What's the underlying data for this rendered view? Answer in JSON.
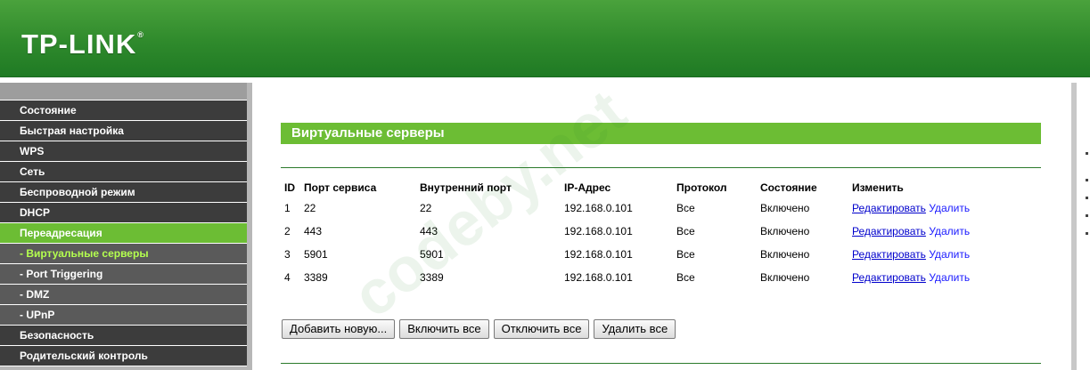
{
  "header": {
    "logo_text": "TP-LINK",
    "logo_mark": "®"
  },
  "sidebar": {
    "items": [
      {
        "label": "Состояние",
        "type": "main",
        "active": false
      },
      {
        "label": "Быстрая настройка",
        "type": "main",
        "active": false
      },
      {
        "label": "WPS",
        "type": "main",
        "active": false
      },
      {
        "label": "Сеть",
        "type": "main",
        "active": false
      },
      {
        "label": "Беспроводной режим",
        "type": "main",
        "active": false
      },
      {
        "label": "DHCP",
        "type": "main",
        "active": false
      },
      {
        "label": "Переадресация",
        "type": "main",
        "active": true
      },
      {
        "label": "- Виртуальные серверы",
        "type": "sub",
        "active": true
      },
      {
        "label": "- Port Triggering",
        "type": "sub",
        "active": false
      },
      {
        "label": "- DMZ",
        "type": "sub",
        "active": false
      },
      {
        "label": "- UPnP",
        "type": "sub",
        "active": false
      },
      {
        "label": "Безопасность",
        "type": "main",
        "active": false
      },
      {
        "label": "Родительский контроль",
        "type": "main",
        "active": false
      }
    ]
  },
  "main": {
    "title": "Виртуальные серверы",
    "table": {
      "headers": [
        "ID",
        "Порт сервиса",
        "Внутренний порт",
        "IP-Адрес",
        "Протокол",
        "Состояние",
        "Изменить"
      ],
      "rows": [
        {
          "id": "1",
          "service_port": "22",
          "internal_port": "22",
          "ip": "192.168.0.101",
          "protocol": "Все",
          "status": "Включено",
          "edit": "Редактировать",
          "delete": "Удалить"
        },
        {
          "id": "2",
          "service_port": "443",
          "internal_port": "443",
          "ip": "192.168.0.101",
          "protocol": "Все",
          "status": "Включено",
          "edit": "Редактировать",
          "delete": "Удалить"
        },
        {
          "id": "3",
          "service_port": "5901",
          "internal_port": "5901",
          "ip": "192.168.0.101",
          "protocol": "Все",
          "status": "Включено",
          "edit": "Редактировать",
          "delete": "Удалить"
        },
        {
          "id": "4",
          "service_port": "3389",
          "internal_port": "3389",
          "ip": "192.168.0.101",
          "protocol": "Все",
          "status": "Включено",
          "edit": "Редактировать",
          "delete": "Удалить"
        }
      ]
    },
    "buttons": {
      "add": "Добавить новую...",
      "enable_all": "Включить все",
      "disable_all": "Отключить все",
      "delete_all": "Удалить все"
    }
  },
  "watermark": {
    "text": "codeby.net"
  },
  "colors": {
    "brand_green": "#2f8a2c",
    "accent_green": "#6cbd34",
    "menu_dark": "#3c3c3c",
    "link": "#0000cc"
  }
}
